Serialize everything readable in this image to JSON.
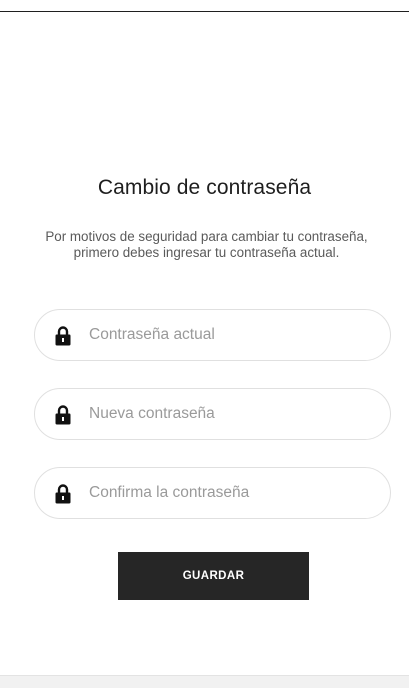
{
  "page": {
    "title": "Cambio de contraseña",
    "description": "Por motivos de seguridad para cambiar tu contraseña, primero debes ingresar tu contraseña actual."
  },
  "form": {
    "current_password": {
      "placeholder": "Contraseña actual",
      "value": "",
      "icon": "lock-icon"
    },
    "new_password": {
      "placeholder": "Nueva contraseña",
      "value": "",
      "icon": "lock-icon"
    },
    "confirm_password": {
      "placeholder": "Confirma la contraseña",
      "value": "",
      "icon": "lock-icon"
    },
    "save_label": "GUARDAR"
  },
  "colors": {
    "button_background": "#262626",
    "button_text": "#ffffff",
    "field_border": "#e0e0e0",
    "placeholder": "#9a9a9a",
    "title_text": "#1e1e1e"
  }
}
